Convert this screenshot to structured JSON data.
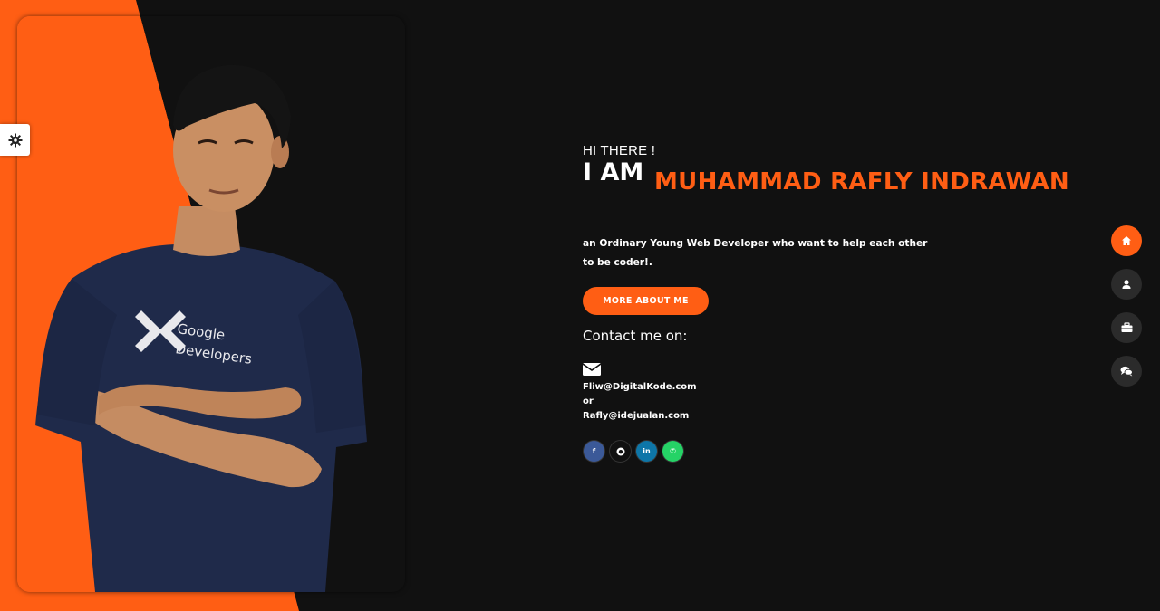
{
  "hero": {
    "greeting": "HI THERE !",
    "i_am": "I AM",
    "name": "MUHAMMAD RAFLY INDRAWAN",
    "bio": "an Ordinary Young Web Developer who want to help each other to be coder!.",
    "more_button": "MORE ABOUT ME"
  },
  "contact": {
    "title": "Contact me on:",
    "email_1": "Fliw@DigitalKode.com",
    "separator": "or",
    "email_2": "Rafly@idejualan.com"
  },
  "photo": {
    "shirt_text_line1": "Google",
    "shirt_text_line2": "Developers"
  },
  "socials": [
    {
      "icon": "facebook-icon",
      "glyph": "f",
      "color": "#3b5998"
    },
    {
      "icon": "github-icon",
      "glyph": "●",
      "color": "#111111"
    },
    {
      "icon": "linkedin-icon",
      "glyph": "in",
      "color": "#0e76a8"
    },
    {
      "icon": "whatsapp-icon",
      "glyph": "✆",
      "color": "#25d366"
    }
  ],
  "side_nav": [
    {
      "icon": "home-icon",
      "active": true
    },
    {
      "icon": "user-icon",
      "active": false
    },
    {
      "icon": "briefcase-icon",
      "active": false
    },
    {
      "icon": "comments-icon",
      "active": false
    }
  ],
  "colors": {
    "accent": "#ff5e14",
    "background": "#111111",
    "nav_inactive": "#2b2b2b"
  }
}
